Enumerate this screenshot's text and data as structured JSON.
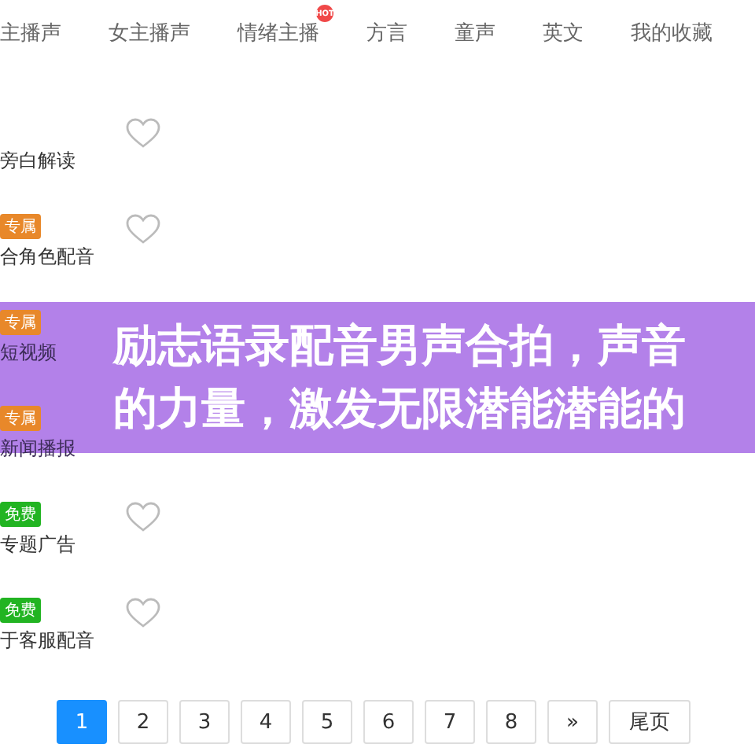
{
  "tabs": [
    {
      "label": "主播声"
    },
    {
      "label": "女主播声"
    },
    {
      "label": "情绪主播",
      "badge": "HOT"
    },
    {
      "label": "方言"
    },
    {
      "label": "童声"
    },
    {
      "label": "英文"
    },
    {
      "label": "我的收藏"
    }
  ],
  "items": [
    {
      "description": "旁白解读"
    },
    {
      "tag": {
        "text": "专属",
        "kind": "exclusive"
      },
      "description": "合角色配音"
    },
    {
      "tag": {
        "text": "专属",
        "kind": "exclusive"
      },
      "description": "短视频",
      "covered": true
    },
    {
      "tag": {
        "text": "专属",
        "kind": "exclusive"
      },
      "description": "新闻播报",
      "covered": true
    },
    {
      "tag": {
        "text": "免费",
        "kind": "free"
      },
      "description": "专题广告"
    },
    {
      "tag": {
        "text": "免费",
        "kind": "free"
      },
      "description": "于客服配音"
    }
  ],
  "overlay_title": "励志语录配音男声合拍，声音的力量，激发无限潜能潜能的",
  "pagination": [
    {
      "label": "1",
      "selected": true
    },
    {
      "label": "2",
      "selected": false
    },
    {
      "label": "3",
      "selected": false
    },
    {
      "label": "4",
      "selected": false
    },
    {
      "label": "5",
      "selected": false
    },
    {
      "label": "6",
      "selected": false
    },
    {
      "label": "7",
      "selected": false
    },
    {
      "label": "8",
      "selected": false
    },
    {
      "label": "»",
      "selected": false
    },
    {
      "label": "尾页",
      "selected": false
    }
  ]
}
